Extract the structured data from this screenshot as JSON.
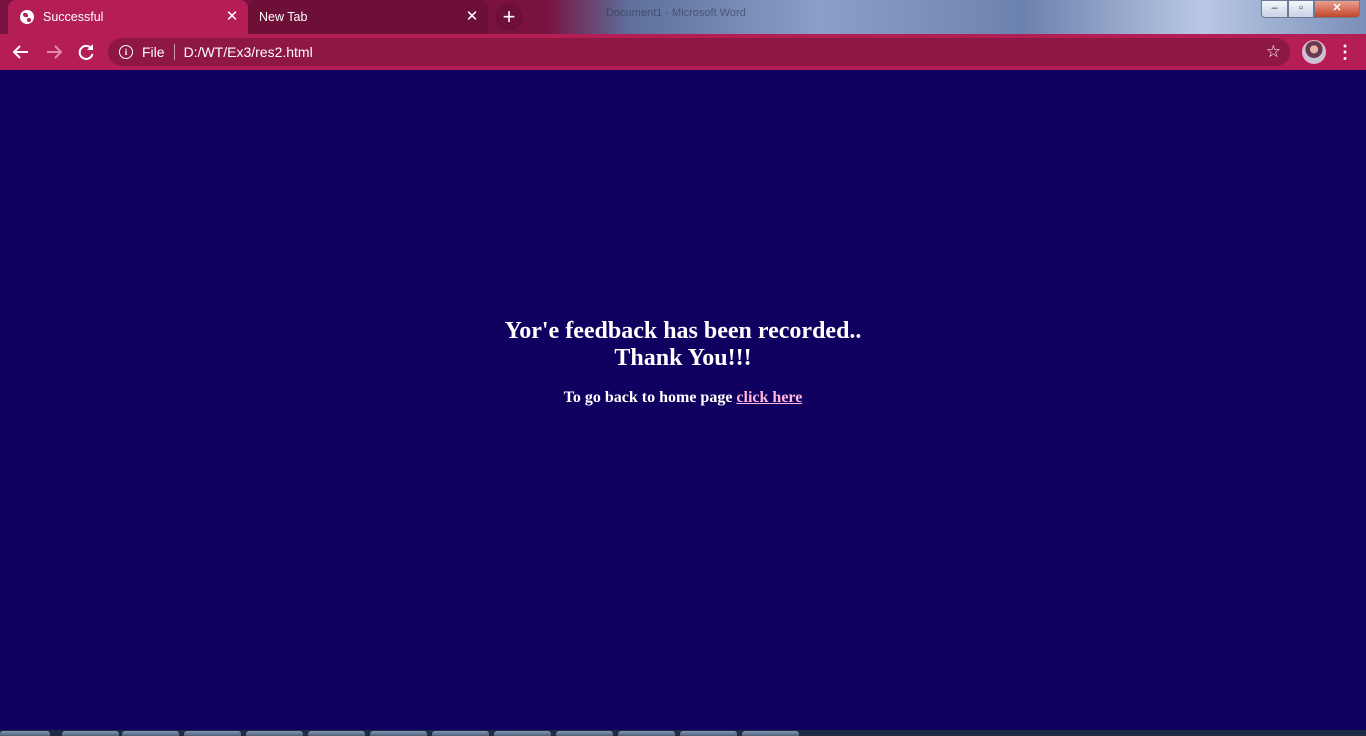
{
  "browser": {
    "tabs": [
      {
        "title": "Successful",
        "active": true
      },
      {
        "title": "New Tab",
        "active": false
      }
    ],
    "new_tab_label": "+",
    "background_window_title": "Document1 - Microsoft Word",
    "address": {
      "scheme_label": "File",
      "url": "D:/WT/Ex3/res2.html"
    },
    "icons": {
      "back": "back-arrow-icon",
      "forward": "forward-arrow-icon",
      "reload": "reload-icon",
      "info": "info-icon",
      "star": "bookmark-star-icon",
      "menu": "menu-dots-icon"
    },
    "colors": {
      "tab_active": "#b51d55",
      "tab_inactive": "#6e0f38",
      "toolbar": "#b51d55",
      "omnibox": "#8e1744"
    }
  },
  "window_controls": {
    "minimize": "–",
    "maximize": "▫",
    "close": "✕"
  },
  "page": {
    "heading_line1": "Yor'e feedback has been recorded..",
    "heading_line2": "Thank You!!!",
    "back_text": "To go back to home page",
    "link_text": "click here",
    "background_color": "#10005f",
    "link_color": "#ffb6da"
  }
}
